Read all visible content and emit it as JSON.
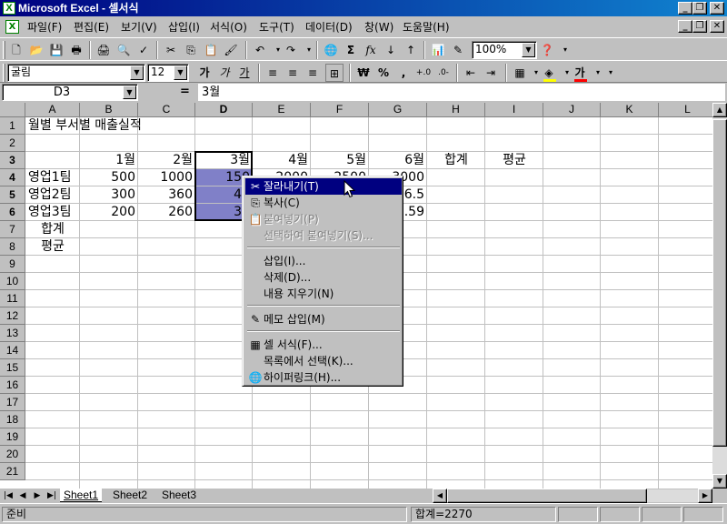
{
  "window": {
    "title": "Microsoft Excel - 셀서식",
    "app_icon_glyph": "X",
    "minimize_glyph": "_",
    "restore_glyph": "❐",
    "close_glyph": "✕"
  },
  "menubar": {
    "items": [
      "파일(F)",
      "편집(E)",
      "보기(V)",
      "삽입(I)",
      "서식(O)",
      "도구(T)",
      "데이터(D)",
      "창(W)",
      "도움말(H)"
    ]
  },
  "standard_toolbar": {
    "zoom": "100%",
    "icons": [
      "new-file-icon",
      "open-folder-icon",
      "save-icon",
      "print-icon",
      "print-preview-icon",
      "spelling-icon",
      "cut-icon",
      "copy-icon",
      "paste-icon",
      "format-painter-icon",
      "undo-icon",
      "redo-icon",
      "hyperlink-icon",
      "autosum-icon",
      "function-icon",
      "sort-ascending-icon",
      "sort-descending-icon",
      "chart-wizard-icon",
      "drawing-icon",
      "help-icon"
    ]
  },
  "format_toolbar": {
    "font": "굴림",
    "size": "12",
    "bold": "가",
    "italic": "가",
    "underline": "가",
    "currency": "₩",
    "percent": "%",
    "comma": ",",
    "font_color_label": "가",
    "fill_color": "#ffff00",
    "font_color": "#ff0000"
  },
  "formula_bar": {
    "name_box": "D3",
    "equals": "=",
    "content": "3월"
  },
  "sheet": {
    "columns": [
      "A",
      "B",
      "C",
      "D",
      "E",
      "F",
      "G",
      "H",
      "I",
      "J",
      "K",
      "L"
    ],
    "selected_column": "D",
    "rows": [
      "1",
      "2",
      "3",
      "4",
      "5",
      "6",
      "7",
      "8",
      "9",
      "10",
      "11",
      "12",
      "13",
      "14",
      "15",
      "16",
      "17",
      "18",
      "19",
      "20",
      "21"
    ],
    "selected_rows": [
      "3",
      "4",
      "5",
      "6"
    ],
    "cells": {
      "A1": "월별 부서별 매출실적",
      "B3": "1월",
      "C3": "2월",
      "D3": "3월",
      "E3": "4월",
      "F3": "5월",
      "G3": "6월",
      "H3": "합계",
      "I3": "평균",
      "A4": "영업1팀",
      "B4": "500",
      "C4": "1000",
      "D4": "150",
      "E4": "2000",
      "F4": "2500",
      "G4": "3000",
      "A5": "영업2팀",
      "B5": "300",
      "C5": "360",
      "D5": "43",
      "G5": "46.5",
      "A6": "영업3팀",
      "B6": "200",
      "C6": "260",
      "D6": "33",
      "G6": "2.59",
      "A7": "합계",
      "A8": "평균"
    },
    "highlight_color": "#8080c8"
  },
  "context_menu": {
    "items": [
      {
        "label": "잘라내기(T)",
        "icon": "✂",
        "state": "hover"
      },
      {
        "label": "복사(C)",
        "icon": "⎘",
        "state": "normal"
      },
      {
        "label": "붙여넣기(P)",
        "icon": "📋",
        "state": "disabled"
      },
      {
        "label": "선택하여 붙여넣기(S)...",
        "icon": "",
        "state": "disabled"
      },
      {
        "label": "삽입(I)...",
        "icon": "",
        "state": "normal"
      },
      {
        "label": "삭제(D)...",
        "icon": "",
        "state": "normal"
      },
      {
        "label": "내용 지우기(N)",
        "icon": "",
        "state": "normal"
      },
      {
        "label": "메모 삽입(M)",
        "icon": "✎",
        "state": "normal"
      },
      {
        "label": "셀 서식(F)...",
        "icon": "▦",
        "state": "normal"
      },
      {
        "label": "목록에서 선택(K)...",
        "icon": "",
        "state": "normal"
      },
      {
        "label": "하이퍼링크(H)...",
        "icon": "🌐",
        "state": "normal"
      }
    ]
  },
  "sheet_tabs": {
    "tabs": [
      "Sheet1",
      "Sheet2",
      "Sheet3"
    ],
    "active": "Sheet1",
    "nav_first": "|◀",
    "nav_prev": "◀",
    "nav_next": "▶",
    "nav_last": "▶|"
  },
  "status_bar": {
    "mode": "준비",
    "sum": "합계=2270"
  }
}
